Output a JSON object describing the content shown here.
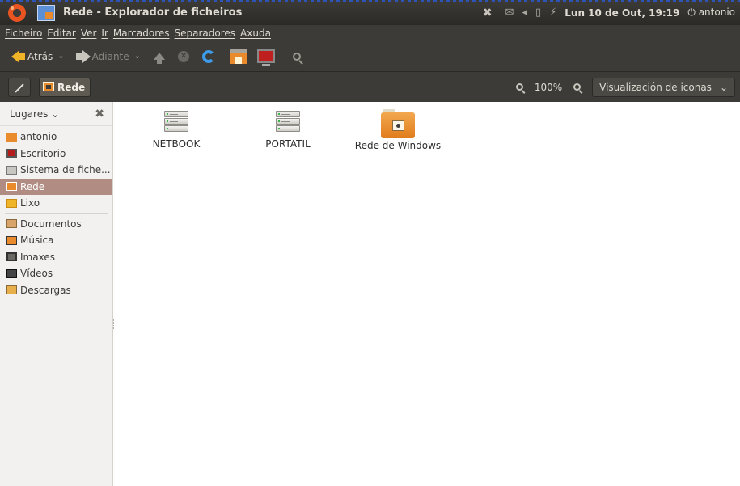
{
  "window": {
    "title": "Rede - Explorador de ficheiros",
    "clock": "Lun 10 de Out, 19:19",
    "user": "antonio"
  },
  "menubar": {
    "items": [
      "Ficheiro",
      "Editar",
      "Ver",
      "Ir",
      "Marcadores",
      "Separadores",
      "Axuda"
    ]
  },
  "toolbar": {
    "back_label": "Atrás",
    "forward_label": "Adiante"
  },
  "location": {
    "crumb": "Rede",
    "zoom": "100%",
    "view_mode": "Visualización de iconas"
  },
  "sidebar": {
    "header": "Lugares",
    "places": [
      {
        "label": "antonio",
        "icon": "home-folder-icon"
      },
      {
        "label": "Escritorio",
        "icon": "desktop-icon"
      },
      {
        "label": "Sistema de fiche...",
        "icon": "filesystem-icon"
      },
      {
        "label": "Rede",
        "icon": "network-icon"
      },
      {
        "label": "Lixo",
        "icon": "trash-icon"
      }
    ],
    "bookmarks": [
      {
        "label": "Documentos",
        "icon": "documents-folder-icon"
      },
      {
        "label": "Música",
        "icon": "music-folder-icon"
      },
      {
        "label": "Imaxes",
        "icon": "pictures-folder-icon"
      },
      {
        "label": "Vídeos",
        "icon": "videos-folder-icon"
      },
      {
        "label": "Descargas",
        "icon": "downloads-folder-icon"
      }
    ],
    "selected": "Rede"
  },
  "content": {
    "items": [
      {
        "label": "NETBOOK",
        "icon": "server-icon"
      },
      {
        "label": "PORTATIL",
        "icon": "server-icon"
      },
      {
        "label": "Rede de Windows",
        "icon": "network-folder-icon"
      }
    ]
  },
  "colors": {
    "panel": "#3c3b37",
    "selection": "#b08c83",
    "accent": "#e98a2c"
  }
}
